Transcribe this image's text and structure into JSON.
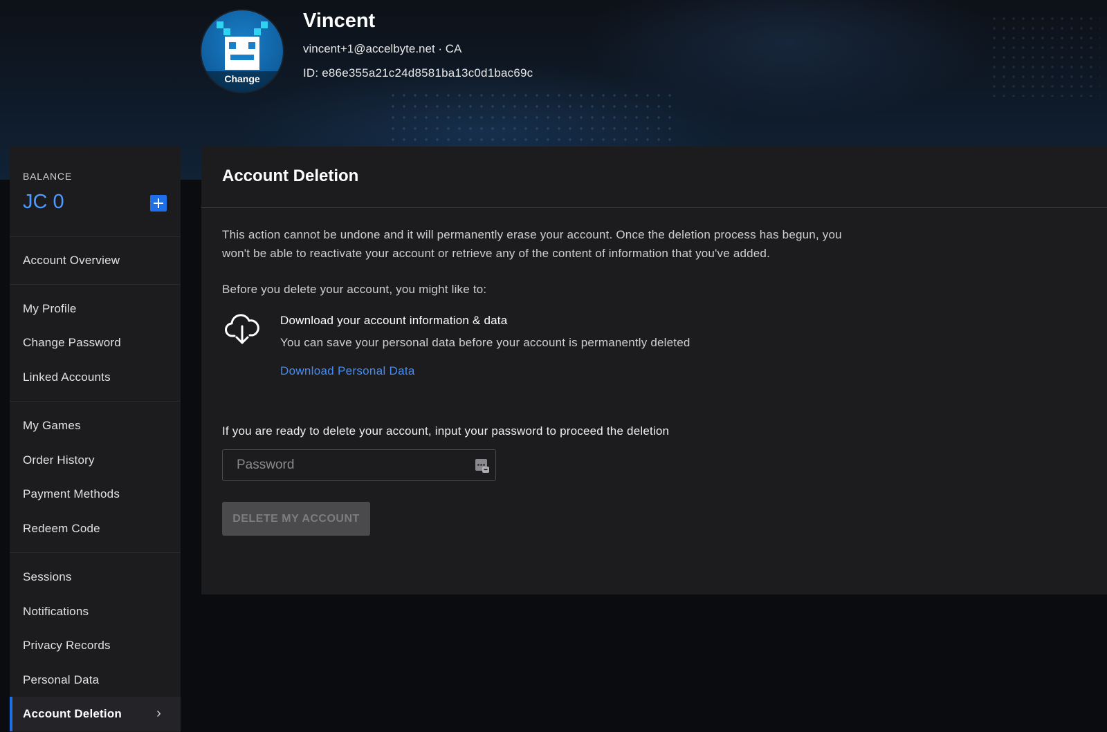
{
  "header": {
    "name": "Vincent",
    "meta": "vincent+1@accelbyte.net · CA",
    "id_text": "ID: e86e355a21c24d8581ba13c0d1bac69c",
    "avatar_change_label": "Change",
    "avatar_icon": "space-invader-icon"
  },
  "sidebar": {
    "balance_label": "BALANCE",
    "balance_value": "JC 0",
    "add_icon": "plus-icon",
    "groups": [
      {
        "items": [
          {
            "label": "Account Overview"
          }
        ]
      },
      {
        "items": [
          {
            "label": "My Profile"
          },
          {
            "label": "Change Password"
          },
          {
            "label": "Linked Accounts"
          }
        ]
      },
      {
        "items": [
          {
            "label": "My Games"
          },
          {
            "label": "Order History"
          },
          {
            "label": "Payment Methods"
          },
          {
            "label": "Redeem Code"
          }
        ]
      },
      {
        "items": [
          {
            "label": "Sessions"
          },
          {
            "label": "Notifications"
          },
          {
            "label": "Privacy Records"
          },
          {
            "label": "Personal Data"
          }
        ]
      }
    ],
    "active_item": {
      "label": "Account Deletion",
      "icon": "chevron-right-icon"
    }
  },
  "main": {
    "title": "Account Deletion",
    "warning": "This action cannot be undone and it will permanently erase your account. Once the deletion process has begun, you won't be able to reactivate your account or retrieve any of the content of information that you've added.",
    "before_text": "Before you delete your account, you might like to:",
    "download": {
      "icon": "cloud-download-icon",
      "title": "Download your account information & data",
      "subtitle": "You can save your personal data before your account is permanently deleted",
      "link": "Download Personal Data"
    },
    "ready_text": "If you are ready to delete your account, input your password to proceed the deletion",
    "password": {
      "placeholder": "Password",
      "value": "",
      "icon": "password-manager-icon"
    },
    "delete_button": "DELETE MY ACCOUNT"
  },
  "colors": {
    "accent": "#1e6fe8",
    "link": "#3f8dff",
    "balance": "#4e9bff",
    "panel": "#1c1c1e"
  }
}
